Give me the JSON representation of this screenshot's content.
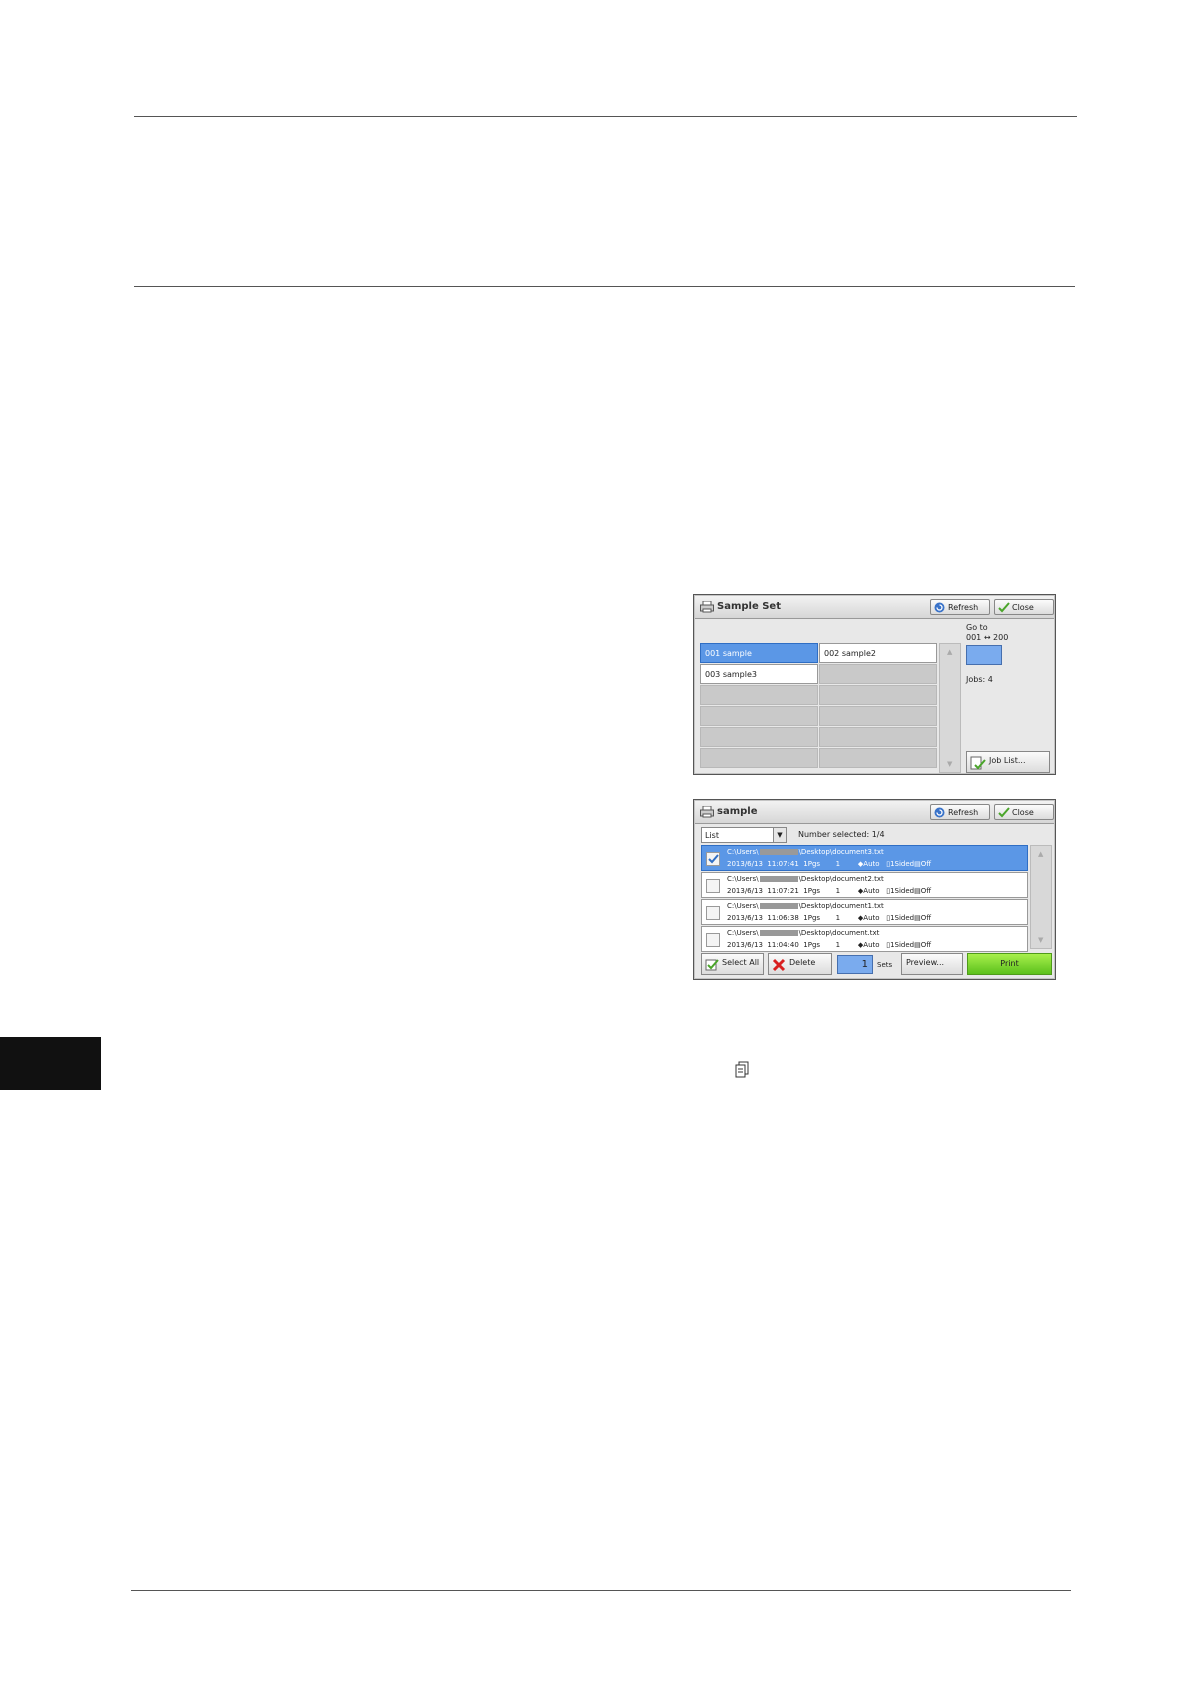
{
  "screen1": {
    "title": "Sample Set",
    "refresh_label": "Refresh",
    "close_label": "Close",
    "cells": [
      "001  sample",
      "002  sample2",
      "003  sample3"
    ],
    "goto_line1": "Go to",
    "goto_line2": "001 ↔ 200",
    "jobs": "Jobs: 4",
    "joblist_label": "Job List..."
  },
  "screen2": {
    "title": "sample",
    "refresh_label": "Refresh",
    "close_label": "Close",
    "view_select": "List",
    "number_selected": "Number selected: 1/4",
    "rows": [
      {
        "path_a": "C:\\Users\\",
        "path_b": "\\Desktop\\document3.txt",
        "date": "2013/6/13",
        "time": "11:07:41",
        "pages": "1Pgs",
        "qty": "1",
        "color": "Auto",
        "sides": "1Sided",
        "staple": "Off"
      },
      {
        "path_a": "C:\\Users\\",
        "path_b": "\\Desktop\\document2.txt",
        "date": "2013/6/13",
        "time": "11:07:21",
        "pages": "1Pgs",
        "qty": "1",
        "color": "Auto",
        "sides": "1Sided",
        "staple": "Off"
      },
      {
        "path_a": "C:\\Users\\",
        "path_b": "\\Desktop\\document1.txt",
        "date": "2013/6/13",
        "time": "11:06:38",
        "pages": "1Pgs",
        "qty": "1",
        "color": "Auto",
        "sides": "1Sided",
        "staple": "Off"
      },
      {
        "path_a": "C:\\Users\\",
        "path_b": "\\Desktop\\document.txt",
        "date": "2013/6/13",
        "time": "11:04:40",
        "pages": "1Pgs",
        "qty": "1",
        "color": "Auto",
        "sides": "1Sided",
        "staple": "Off"
      }
    ],
    "select_all_label": "Select All",
    "delete_label": "Delete",
    "sets_value": "1",
    "sets_label": "Sets",
    "preview_label": "Preview...",
    "print_label": "Print"
  },
  "colors": {
    "selected": "#5b97e6",
    "print": "#5cc01c",
    "side_tab": "#111111"
  }
}
